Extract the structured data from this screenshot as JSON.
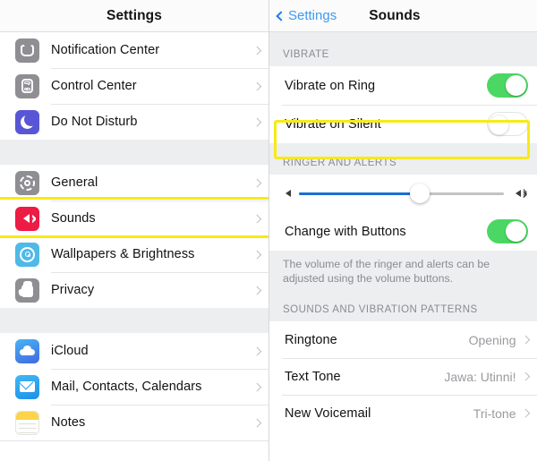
{
  "left": {
    "nav_title": "Settings",
    "groups": [
      {
        "items": [
          {
            "label": "Notification Center",
            "icon": "notification-center-icon",
            "icon_class": "ic-gray",
            "glyph": "notif"
          },
          {
            "label": "Control Center",
            "icon": "control-center-icon",
            "icon_class": "ic-gray",
            "glyph": "ctrl"
          },
          {
            "label": "Do Not Disturb",
            "icon": "moon-icon",
            "icon_class": "ic-purple",
            "glyph": "moon"
          }
        ]
      },
      {
        "items": [
          {
            "label": "General",
            "icon": "gear-icon",
            "icon_class": "ic-gray",
            "glyph": "gear"
          },
          {
            "label": "Sounds",
            "icon": "speaker-icon",
            "icon_class": "ic-red",
            "glyph": "speaker",
            "highlighted": true
          },
          {
            "label": "Wallpapers & Brightness",
            "icon": "flower-icon",
            "icon_class": "ic-ltblue",
            "glyph": "flower"
          },
          {
            "label": "Privacy",
            "icon": "hand-icon",
            "icon_class": "ic-gray",
            "glyph": "hand"
          }
        ]
      },
      {
        "items": [
          {
            "label": "iCloud",
            "icon": "cloud-icon",
            "icon_class": "ic-cloud",
            "glyph": "cloud"
          },
          {
            "label": "Mail, Contacts, Calendars",
            "icon": "envelope-icon",
            "icon_class": "ic-mail",
            "glyph": "envelope"
          },
          {
            "label": "Notes",
            "icon": "notes-icon",
            "icon_class": "ic-notes",
            "glyph": "notes"
          }
        ]
      }
    ]
  },
  "right": {
    "back_label": "Settings",
    "nav_title": "Sounds",
    "vibrate": {
      "header": "VIBRATE",
      "rows": [
        {
          "label": "Vibrate on Ring",
          "toggle": "on"
        },
        {
          "label": "Vibrate on Silent",
          "toggle": "off",
          "highlighted": true
        }
      ]
    },
    "ringer": {
      "header": "RINGER AND ALERTS",
      "volume_percent": 59,
      "change_with_buttons": {
        "label": "Change with Buttons",
        "toggle": "on"
      },
      "footer": "The volume of the ringer and alerts can be adjusted using the volume buttons."
    },
    "patterns": {
      "header": "SOUNDS AND VIBRATION PATTERNS",
      "rows": [
        {
          "label": "Ringtone",
          "value": "Opening"
        },
        {
          "label": "Text Tone",
          "value": "Jawa: Utinni!"
        },
        {
          "label": "New Voicemail",
          "value": "Tri-tone"
        }
      ]
    }
  },
  "colors": {
    "accent_blue": "#3b9bf0",
    "toggle_on_green": "#4bd763",
    "slider_blue": "#1a6fd4",
    "highlight_yellow": "#f7ea16",
    "group_bg": "#eceef0"
  }
}
